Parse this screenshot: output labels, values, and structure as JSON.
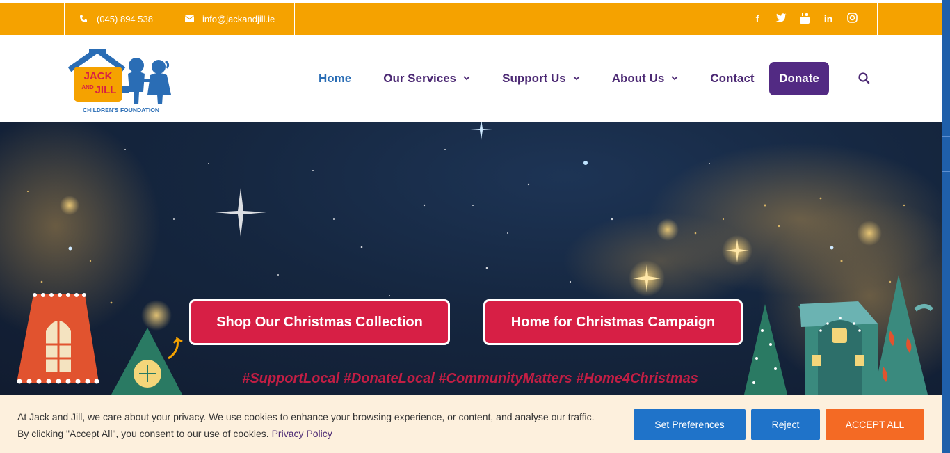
{
  "topbar": {
    "phone": "(045) 894 538",
    "email": "info@jackandjill.ie",
    "social_icons": [
      "facebook-icon",
      "twitter-icon",
      "youtube-icon",
      "linkedin-icon",
      "instagram-icon"
    ]
  },
  "logo": {
    "line1": "JACK",
    "line2": "AND",
    "line3": "JILL",
    "tagline": "CHILDREN'S FOUNDATION"
  },
  "nav": {
    "items": [
      {
        "label": "Home",
        "active": true
      },
      {
        "label": "Our Services",
        "dropdown": true
      },
      {
        "label": "Support Us",
        "dropdown": true
      },
      {
        "label": "About Us",
        "dropdown": true
      },
      {
        "label": "Contact"
      }
    ],
    "donate_label": "Donate"
  },
  "hero": {
    "cta_primary": "Shop Our Christmas Collection",
    "cta_secondary": "Home for Christmas Campaign",
    "hashtags": "#SupportLocal #DonateLocal #CommunityMatters #Home4Christmas"
  },
  "cookie": {
    "text_line1": "At Jack and Jill, we care about your privacy. We use cookies to enhance your browsing experience, or content, and analyse our traffic.",
    "text_line2": "By clicking \"Accept All\", you consent to our use of cookies.",
    "policy_link": "Privacy Policy",
    "set_preferences": "Set Preferences",
    "reject": "Reject",
    "accept_all": "ACCEPT ALL"
  },
  "colors": {
    "topbar": "#f5a200",
    "nav_text": "#4b2873",
    "nav_active": "#2a6db5",
    "donate_bg": "#522a83",
    "cta_bg": "#d71f45",
    "cookie_bg": "#fdf0dd",
    "button_blue": "#1f73c9",
    "button_orange": "#f46a24"
  }
}
